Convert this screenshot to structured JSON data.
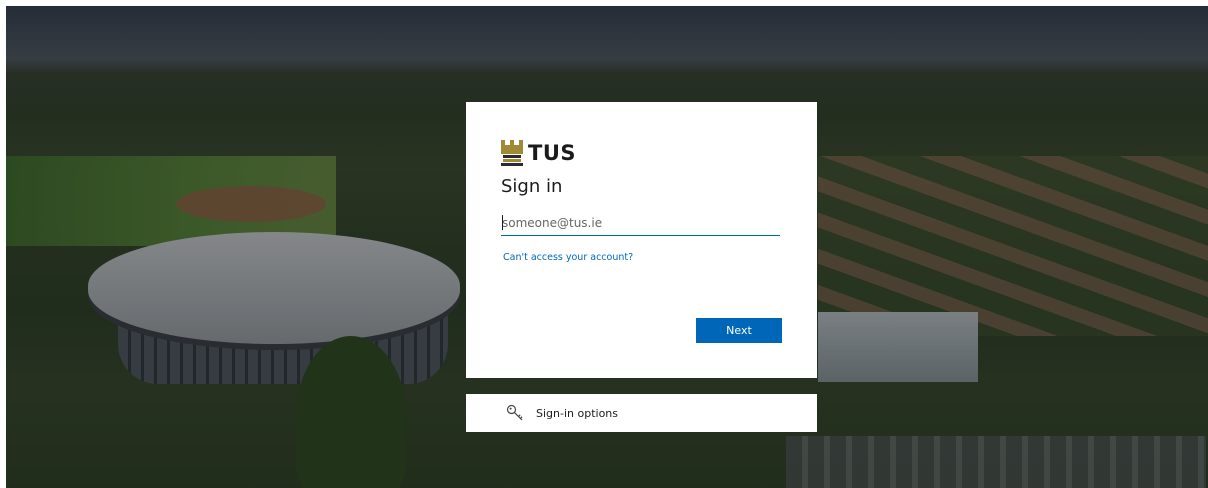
{
  "brand": {
    "name": "TUS",
    "colors": {
      "logo_gold": "#a08a36",
      "accent": "#0067b8",
      "text": "#1b1b1b"
    },
    "logo_icon": "tus-tower-icon"
  },
  "signin": {
    "title": "Sign in",
    "email_placeholder": "someone@tus.ie",
    "email_value": "",
    "cant_access_link": "Can't access your account?",
    "next_label": "Next"
  },
  "options": {
    "label": "Sign-in options",
    "icon": "key-icon"
  }
}
